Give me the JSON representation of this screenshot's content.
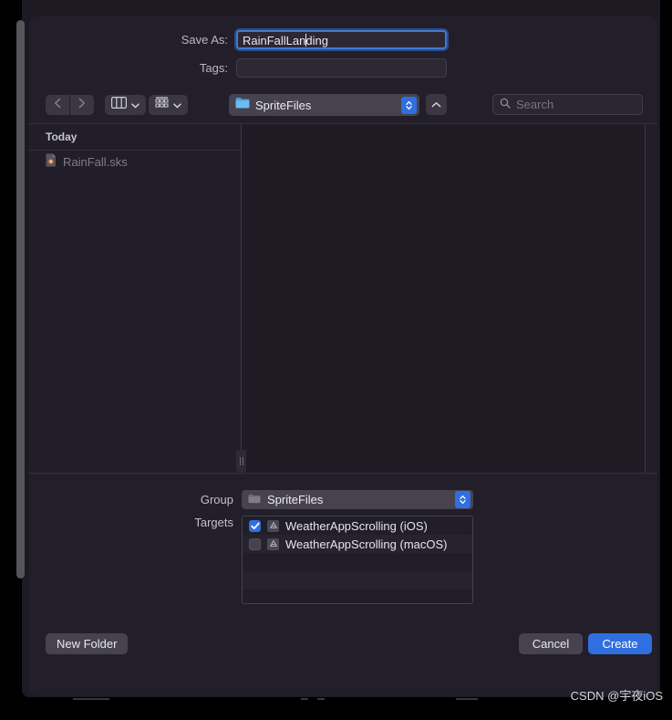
{
  "dialog": {
    "save_as_label": "Save As:",
    "save_as_value_before_caret": "RainFallLan",
    "save_as_value_after_caret": "ding",
    "tags_label": "Tags:",
    "tags_value": ""
  },
  "toolbar": {
    "back_icon": "chevron-left-icon",
    "forward_icon": "chevron-right-icon",
    "column_view_icon": "column-view-icon",
    "grid_view_icon": "grid-view-icon",
    "path_label": "SpriteFiles",
    "path_folder_icon": "folder-icon",
    "stepper_icon": "up-down-stepper-icon",
    "up_icon": "chevron-up-icon",
    "search_icon": "search-icon",
    "search_placeholder": "Search",
    "search_value": ""
  },
  "sidebar": {
    "section_header": "Today",
    "items": [
      {
        "label": "RainFall.sks",
        "icon": "file-icon"
      }
    ]
  },
  "options": {
    "group_label": "Group",
    "group_value": "SpriteFiles",
    "group_folder_icon": "folder-icon",
    "targets_label": "Targets",
    "targets": [
      {
        "label": "WeatherAppScrolling (iOS)",
        "checked": true
      },
      {
        "label": "WeatherAppScrolling (macOS)",
        "checked": false
      }
    ]
  },
  "buttons": {
    "new_folder": "New Folder",
    "cancel": "Cancel",
    "create": "Create"
  },
  "watermark": "CSDN @宇夜iOS",
  "colors": {
    "accent": "#2f6fe0",
    "sheet_bg": "#221f2a",
    "control_bg": "#46434f",
    "text": "#e8e6ec"
  }
}
